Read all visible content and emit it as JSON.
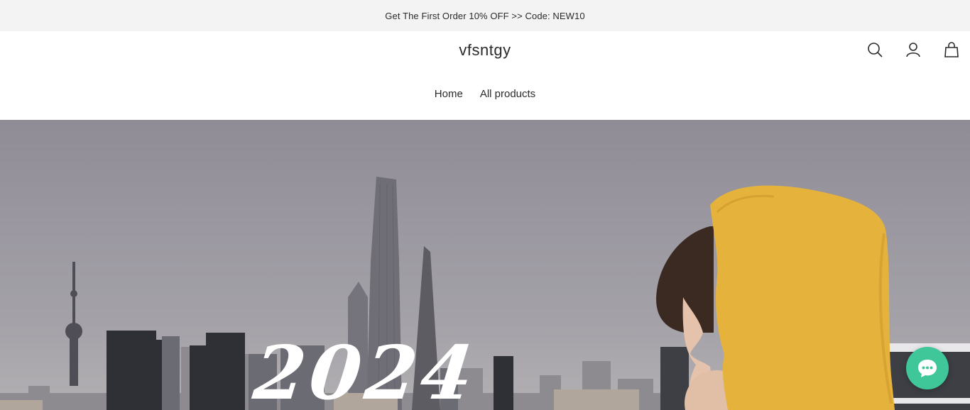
{
  "announcement": {
    "text": "Get The First Order 10% OFF >> Code: NEW10"
  },
  "header": {
    "logo": "vfsntgy",
    "icons": [
      "search-icon",
      "account-icon",
      "cart-icon"
    ]
  },
  "nav": {
    "items": [
      {
        "label": "Home"
      },
      {
        "label": "All products"
      }
    ]
  },
  "hero": {
    "headline": "2024"
  },
  "chat": {
    "icon": "chat-bubble-icon",
    "color": "#3fc79a"
  },
  "colors": {
    "announcement_bg": "#f3f3f3",
    "hood": "#e5b33c"
  }
}
